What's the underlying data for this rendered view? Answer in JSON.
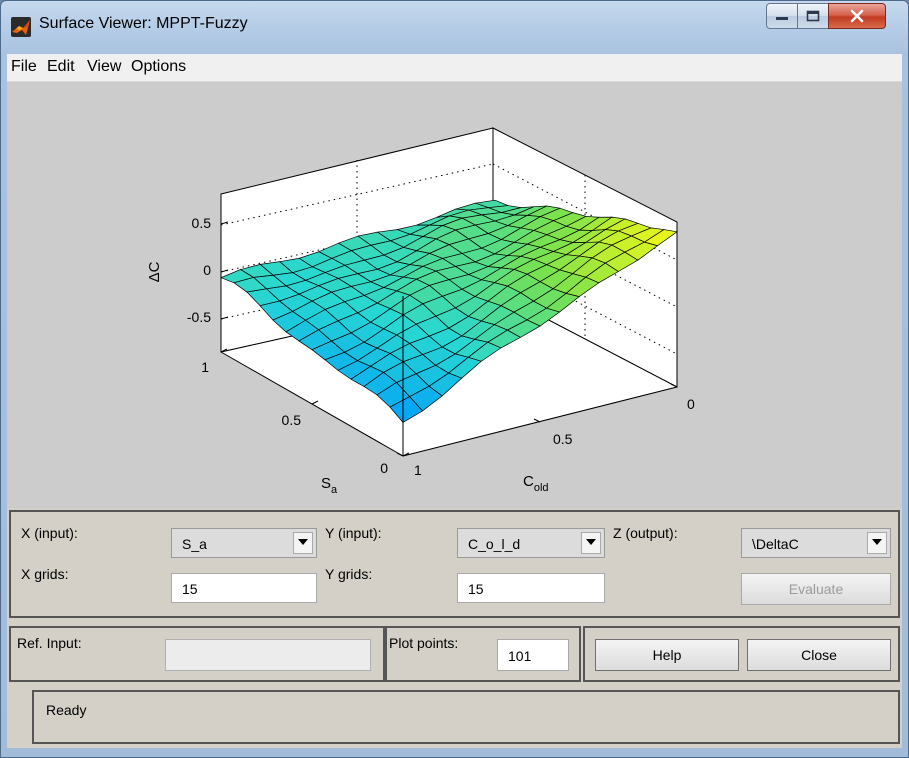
{
  "window": {
    "title": "Surface Viewer: MPPT-Fuzzy"
  },
  "menu": [
    "File",
    "Edit",
    "View",
    "Options"
  ],
  "plot": {
    "zlabel": "ΔC",
    "x_var": "S",
    "x_sub": "a",
    "y_var": "C",
    "y_sub": "old",
    "z_ticks": [
      "0.5",
      "0",
      "-0.5"
    ],
    "sa_ticks": [
      "1",
      "0.5",
      "0"
    ],
    "cold_ticks": [
      "1",
      "0.5",
      "0"
    ]
  },
  "chart_data": {
    "type": "surface",
    "x_name": "S_a",
    "y_name": "C_o_l_d",
    "z_name": "ΔC",
    "x_range": [
      0,
      1
    ],
    "y_range": [
      0,
      1
    ],
    "z_range": [
      -0.9,
      0.8
    ],
    "grid": true,
    "colormap": "parula-like (blue-cyan-green-yellow)"
  },
  "controls": {
    "x_input_label": "X (input):",
    "x_input_value": "S_a",
    "y_input_label": "Y (input):",
    "y_input_value": "C_o_l_d",
    "z_output_label": "Z (output):",
    "z_output_value": "\\DeltaC",
    "x_grids_label": "X grids:",
    "x_grids_value": "15",
    "y_grids_label": "Y grids:",
    "y_grids_value": "15",
    "evaluate_label": "Evaluate",
    "ref_input_label": "Ref. Input:",
    "plot_points_label": "Plot points:",
    "plot_points_value": "101",
    "help_label": "Help",
    "close_label": "Close",
    "status": "Ready"
  }
}
